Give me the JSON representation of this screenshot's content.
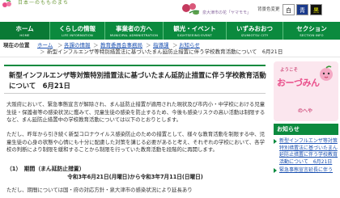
{
  "header": {
    "tagline": "日本一のもものまち",
    "city_mark": "泉大津市の花「ヤマモモ」",
    "contrast_label": "背景色変更",
    "contrast_options": [
      "白",
      "青",
      "黒"
    ]
  },
  "nav": [
    {
      "label": "ホーム",
      "sub": "HOME"
    },
    {
      "label": "くらしの情報",
      "sub": "LIFE INFORMATION"
    },
    {
      "label": "事業者の方へ",
      "sub": "MUNICIPAL ADMINISTRATION"
    },
    {
      "label": "観光・イベント",
      "sub": "SIGHTSEEING·EVENT"
    },
    {
      "label": "いずみおおつ",
      "sub": "IZUMIOTSU CITY"
    },
    {
      "label": "セクション",
      "sub": "SECTION·INFO"
    }
  ],
  "breadcrumb": {
    "now_label": "現在の位置",
    "items": [
      "ホーム",
      "各課の情報",
      "教育委員会事務局",
      "指導課",
      "お知らせ"
    ],
    "current": "新型インフルエンザ等特別措置法に基づいたまん延防止措置に伴う学校教育活動について　6月21日"
  },
  "article": {
    "title": "新型インフルエンザ等対策特別措置法に基づいたまん延防止措置に伴う学校教育活動について　6月21日",
    "para1": "大阪府において、緊急事態宣言が解除され、まん延防止措置が適用された現状及び市内小・中学校における児童生徒・保護者等の感染状況に鑑みて、児童生徒の感染を防止するため、今後も感染リスクの高い活動は制限するなど、まん延防止措置中の学校教育活動については以下のとおりとします。",
    "para2": "ただし、昨年から引き続く新型コロナウイルス感染防止のための措置として、様々な教育活動を制限する中、児童生徒の心身の状態や心情にも十分に配慮した対策を講じる必要があると考え、それぞれの学校において、各学校の判断により制限を緩和することから制限を行っていた教育活動を段階的に再開します。",
    "section_heading": "（1）　期間（まん延防止措置）",
    "period": "令和3年6月21日(月曜日)から令和3年7月11日(日曜日)",
    "para3": "ただし、期間については国・府の対応方針・泉大津市の感染状況により延長あり"
  },
  "sidebar": {
    "banner_small": "ようこそ",
    "banner_big": "おーづみん",
    "banner_end": "のへや",
    "oshirase_heading": "お知らせ",
    "notices": [
      "新型インフルエンザ等対策特別措置法に基づいたまん延防止措置に伴う学校教育活動について　6月21日",
      "緊急事態宣言延長に伴う"
    ]
  },
  "colors": {
    "nav_green": "#0b8a3e",
    "link_blue": "#1a50b0",
    "banner_pink": "#e94e8a"
  }
}
